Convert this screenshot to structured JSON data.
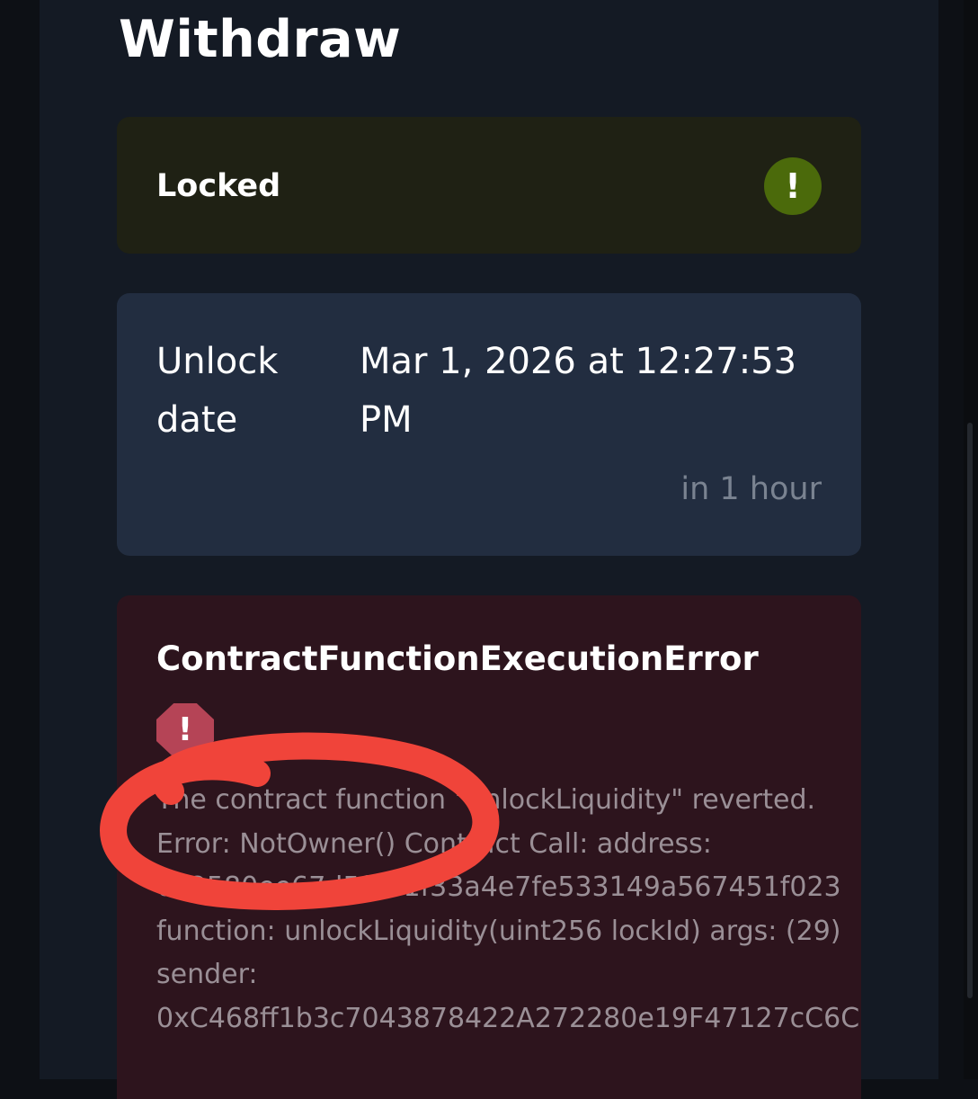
{
  "page": {
    "title": "Withdraw"
  },
  "status_card": {
    "label": "Locked",
    "icon": "exclamation-circle-icon",
    "icon_glyph": "!",
    "accent_color": "#4b6a0b"
  },
  "unlock_card": {
    "label_line1": "Unlock",
    "label_line2": "date",
    "value_line1": "Mar 1, 2026 at 12:27:53",
    "value_line2": "PM",
    "relative": "in 1 hour"
  },
  "error_card": {
    "title": "ContractFunctionExecutionError",
    "icon": "exclamation-octagon-icon",
    "icon_glyph": "!",
    "accent_color": "#b54456",
    "message_lines": [
      "The contract function \"unlockLiquidity\" reverted.",
      "Error: NotOwner() Contract Call: address:",
      "0x2580ee67d5f1e1f33a4e7fe533149a567451f023",
      "function: unlockLiquidity(uint256 lockId) args: (29)",
      "sender:",
      "0xC468ff1b3c7043878422A272280e19F47127cC6C"
    ]
  },
  "annotation": {
    "shape": "hand-drawn-circle",
    "color": "#f0443a"
  }
}
